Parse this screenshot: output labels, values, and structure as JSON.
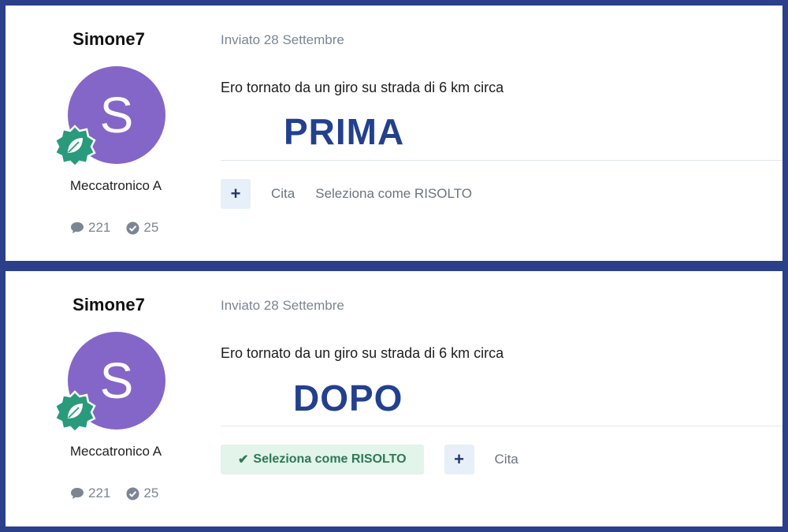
{
  "panels": {
    "prima": {
      "author": {
        "username": "Simone7",
        "avatar_letter": "S",
        "rank": "Meccatronico A",
        "posts_count": "221",
        "solved_count": "25",
        "badge_icon": "leaf-badge-icon"
      },
      "post": {
        "date": "Inviato 28 Settembre",
        "body": "Ero tornato da un giro su strada di 6 km circa",
        "label": "PRIMA"
      },
      "actions": {
        "plus": "+",
        "quote": "Cita",
        "mark_solved": "Seleziona come RISOLTO"
      }
    },
    "dopo": {
      "author": {
        "username": "Simone7",
        "avatar_letter": "S",
        "rank": "Meccatronico A",
        "posts_count": "221",
        "solved_count": "25",
        "badge_icon": "leaf-badge-icon"
      },
      "post": {
        "date": "Inviato 28 Settembre",
        "body": "Ero tornato da un giro su strada di 6 km circa",
        "label": "DOPO"
      },
      "actions": {
        "solved_check": "✔",
        "mark_solved": "Seleziona come RISOLTO",
        "plus": "+",
        "quote": "Cita"
      }
    }
  },
  "colors": {
    "frame": "#2c3f8a",
    "avatar": "#8466c8",
    "badge": "#2a9a7c",
    "label": "#23408f",
    "solved_bg": "#e3f4ea",
    "solved_text": "#2e7a55"
  }
}
